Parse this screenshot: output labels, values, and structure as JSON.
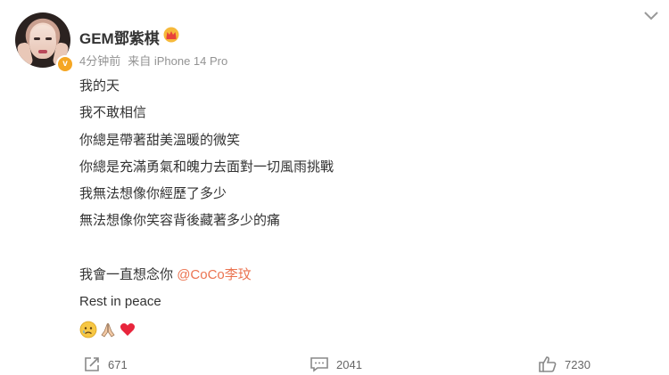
{
  "post": {
    "author": "GEM鄧紫棋",
    "time": "4分钟前",
    "source": "来自 iPhone 14 Pro",
    "lines": [
      "我的天",
      "我不敢相信",
      "你總是帶著甜美溫暖的微笑",
      "你總是充滿勇氣和魄力去面對一切風雨挑戰",
      "我無法想像你經歷了多少",
      "無法想像你笑容背後藏著多少的痛",
      "",
      "我會一直想念你"
    ],
    "mention": "@CoCo李玟",
    "rest_line": "Rest in peace",
    "emojis": [
      "sad-face-emoji",
      "praying-hands-emoji",
      "red-heart-emoji"
    ]
  },
  "actions": {
    "repost_count": "671",
    "comment_count": "2041",
    "like_count": "7230"
  },
  "icons": {
    "verified": "verified-badge-icon",
    "crown": "crown-icon",
    "more": "chevron-down-icon",
    "repost": "repost-icon",
    "comment": "comment-icon",
    "like": "thumbs-up-icon"
  },
  "colors": {
    "mention": "#eb7350",
    "verified": "#f5a623",
    "meta": "#939393"
  }
}
